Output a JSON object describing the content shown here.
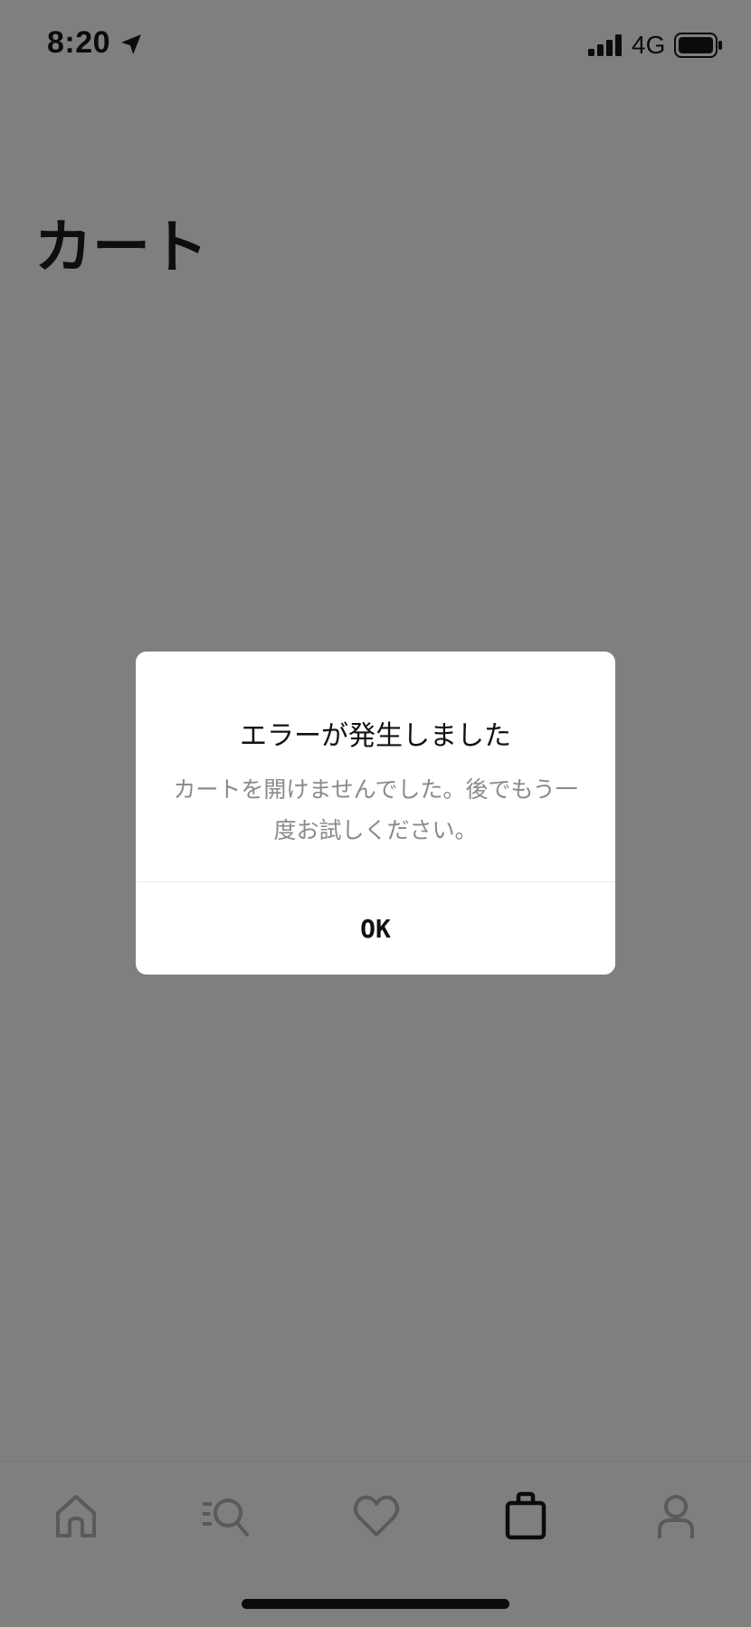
{
  "status_bar": {
    "time": "8:20",
    "network": "4G",
    "icons": [
      "location-arrow-icon",
      "signal-icon",
      "battery-icon"
    ]
  },
  "page": {
    "title": "カート"
  },
  "dialog": {
    "title": "エラーが発生しました",
    "message": "カートを開けませんでした。後でもう一度お試しください。",
    "ok_label": "OK"
  },
  "tab_bar": {
    "tabs": [
      {
        "icon": "home-icon",
        "selected": false
      },
      {
        "icon": "search-icon",
        "selected": false
      },
      {
        "icon": "heart-icon",
        "selected": false
      },
      {
        "icon": "bag-icon",
        "selected": true
      },
      {
        "icon": "person-icon",
        "selected": false
      }
    ]
  },
  "colors": {
    "overlay_background": "#7f7f7f",
    "dialog_background": "#ffffff",
    "inactive_icon": "#5a5a5a",
    "active_icon": "#0b0b0b",
    "message_text": "#8a8a8a"
  }
}
